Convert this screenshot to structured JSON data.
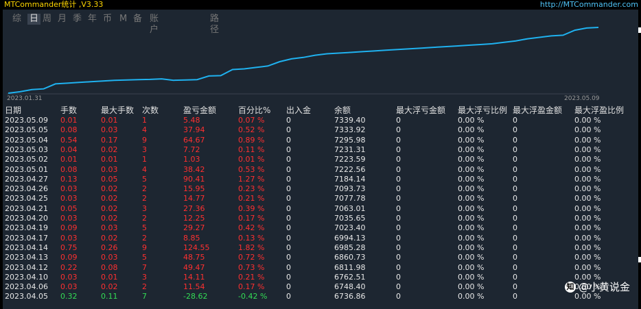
{
  "window": {
    "title": "MTCommander统计 ,V3.33",
    "url": "http://MTCommander.com"
  },
  "tabs": [
    {
      "label": "综",
      "active": false
    },
    {
      "label": "日",
      "active": true
    },
    {
      "label": "周",
      "active": false
    },
    {
      "label": "月",
      "active": false
    },
    {
      "label": "季",
      "active": false
    },
    {
      "label": "年",
      "active": false
    },
    {
      "label": "币",
      "active": false
    },
    {
      "label": "M",
      "active": false
    },
    {
      "label": "备",
      "active": false
    },
    {
      "label": "账户",
      "active": false
    },
    {
      "label": "路径",
      "active": false
    }
  ],
  "chart_data": {
    "type": "line",
    "x_start_label": "2023.01.31",
    "x_end_label": "2023.05.09",
    "values": [
      6420,
      6440,
      6470,
      6480,
      6550,
      6560,
      6570,
      6580,
      6590,
      6600,
      6605,
      6610,
      6612,
      6620,
      6600,
      6605,
      6610,
      6660,
      6665,
      6750,
      6760,
      6780,
      6800,
      6860,
      6900,
      6920,
      6950,
      6970,
      6980,
      6990,
      7000,
      7010,
      7020,
      7030,
      7040,
      7050,
      7060,
      7070,
      7080,
      7090,
      7100,
      7110,
      7130,
      7150,
      7180,
      7200,
      7220,
      7230,
      7300,
      7330,
      7339
    ],
    "line_color": "#1fb2f0"
  },
  "table": {
    "headers": [
      "日期",
      "手数",
      "最大手数",
      "次数",
      "盈亏金额",
      "百分比%",
      "出入金",
      "余额",
      "最大浮亏金额",
      "最大浮亏比例",
      "最大浮盈金额",
      "最大浮盈比例"
    ],
    "rows": [
      {
        "date": "2023.05.09",
        "lots": "0.01",
        "max_lots": "0.01",
        "count": "1",
        "pnl": "5.48",
        "pct": "0.07 %",
        "io": "0",
        "balance": "7339.40",
        "mfl": "0",
        "mflp": "0.00 %",
        "mfp": "0",
        "mfpp": "0.00 %",
        "sign": "pos"
      },
      {
        "date": "2023.05.05",
        "lots": "0.08",
        "max_lots": "0.03",
        "count": "4",
        "pnl": "37.94",
        "pct": "0.52 %",
        "io": "0",
        "balance": "7333.92",
        "mfl": "0",
        "mflp": "0.00 %",
        "mfp": "0",
        "mfpp": "0.00 %",
        "sign": "pos"
      },
      {
        "date": "2023.05.04",
        "lots": "0.54",
        "max_lots": "0.17",
        "count": "9",
        "pnl": "64.67",
        "pct": "0.89 %",
        "io": "0",
        "balance": "7295.98",
        "mfl": "0",
        "mflp": "0.00 %",
        "mfp": "0",
        "mfpp": "0.00 %",
        "sign": "pos"
      },
      {
        "date": "2023.05.03",
        "lots": "0.04",
        "max_lots": "0.02",
        "count": "3",
        "pnl": "7.72",
        "pct": "0.11 %",
        "io": "0",
        "balance": "7231.31",
        "mfl": "0",
        "mflp": "0.00 %",
        "mfp": "0",
        "mfpp": "0.00 %",
        "sign": "pos"
      },
      {
        "date": "2023.05.02",
        "lots": "0.01",
        "max_lots": "0.01",
        "count": "1",
        "pnl": "1.03",
        "pct": "0.01 %",
        "io": "0",
        "balance": "7223.59",
        "mfl": "0",
        "mflp": "0.00 %",
        "mfp": "0",
        "mfpp": "0.00 %",
        "sign": "pos"
      },
      {
        "date": "2023.05.01",
        "lots": "0.08",
        "max_lots": "0.03",
        "count": "4",
        "pnl": "38.42",
        "pct": "0.53 %",
        "io": "0",
        "balance": "7222.56",
        "mfl": "0",
        "mflp": "0.00 %",
        "mfp": "0",
        "mfpp": "0.00 %",
        "sign": "pos"
      },
      {
        "date": "2023.04.27",
        "lots": "0.13",
        "max_lots": "0.05",
        "count": "5",
        "pnl": "90.41",
        "pct": "1.27 %",
        "io": "0",
        "balance": "7184.14",
        "mfl": "0",
        "mflp": "0.00 %",
        "mfp": "0",
        "mfpp": "0.00 %",
        "sign": "pos"
      },
      {
        "date": "2023.04.26",
        "lots": "0.03",
        "max_lots": "0.02",
        "count": "2",
        "pnl": "15.95",
        "pct": "0.23 %",
        "io": "0",
        "balance": "7093.73",
        "mfl": "0",
        "mflp": "0.00 %",
        "mfp": "0",
        "mfpp": "0.00 %",
        "sign": "pos"
      },
      {
        "date": "2023.04.25",
        "lots": "0.03",
        "max_lots": "0.02",
        "count": "2",
        "pnl": "14.77",
        "pct": "0.21 %",
        "io": "0",
        "balance": "7077.78",
        "mfl": "0",
        "mflp": "0.00 %",
        "mfp": "0",
        "mfpp": "0.00 %",
        "sign": "pos"
      },
      {
        "date": "2023.04.21",
        "lots": "0.05",
        "max_lots": "0.02",
        "count": "3",
        "pnl": "27.36",
        "pct": "0.39 %",
        "io": "0",
        "balance": "7063.01",
        "mfl": "0",
        "mflp": "0.00 %",
        "mfp": "0",
        "mfpp": "0.00 %",
        "sign": "pos"
      },
      {
        "date": "2023.04.20",
        "lots": "0.03",
        "max_lots": "0.02",
        "count": "2",
        "pnl": "12.25",
        "pct": "0.17 %",
        "io": "0",
        "balance": "7035.65",
        "mfl": "0",
        "mflp": "0.00 %",
        "mfp": "0",
        "mfpp": "0.00 %",
        "sign": "pos"
      },
      {
        "date": "2023.04.19",
        "lots": "0.09",
        "max_lots": "0.03",
        "count": "5",
        "pnl": "29.27",
        "pct": "0.42 %",
        "io": "0",
        "balance": "7023.40",
        "mfl": "0",
        "mflp": "0.00 %",
        "mfp": "0",
        "mfpp": "0.00 %",
        "sign": "pos"
      },
      {
        "date": "2023.04.17",
        "lots": "0.03",
        "max_lots": "0.02",
        "count": "2",
        "pnl": "8.85",
        "pct": "0.13 %",
        "io": "0",
        "balance": "6994.13",
        "mfl": "0",
        "mflp": "0.00 %",
        "mfp": "0",
        "mfpp": "0.00 %",
        "sign": "pos"
      },
      {
        "date": "2023.04.14",
        "lots": "0.75",
        "max_lots": "0.26",
        "count": "9",
        "pnl": "124.55",
        "pct": "1.82 %",
        "io": "0",
        "balance": "6985.28",
        "mfl": "0",
        "mflp": "0.00 %",
        "mfp": "0",
        "mfpp": "0.00 %",
        "sign": "pos"
      },
      {
        "date": "2023.04.13",
        "lots": "0.09",
        "max_lots": "0.03",
        "count": "5",
        "pnl": "48.75",
        "pct": "0.72 %",
        "io": "0",
        "balance": "6860.73",
        "mfl": "0",
        "mflp": "0.00 %",
        "mfp": "0",
        "mfpp": "0.00 %",
        "sign": "pos"
      },
      {
        "date": "2023.04.12",
        "lots": "0.22",
        "max_lots": "0.08",
        "count": "7",
        "pnl": "49.47",
        "pct": "0.73 %",
        "io": "0",
        "balance": "6811.98",
        "mfl": "0",
        "mflp": "0.00 %",
        "mfp": "0",
        "mfpp": "0.00 %",
        "sign": "pos"
      },
      {
        "date": "2023.04.10",
        "lots": "0.03",
        "max_lots": "0.01",
        "count": "3",
        "pnl": "14.11",
        "pct": "0.21 %",
        "io": "0",
        "balance": "6762.51",
        "mfl": "0",
        "mflp": "0.00 %",
        "mfp": "0",
        "mfpp": "0.00 %",
        "sign": "pos"
      },
      {
        "date": "2023.04.06",
        "lots": "0.03",
        "max_lots": "0.02",
        "count": "2",
        "pnl": "11.54",
        "pct": "0.17 %",
        "io": "0",
        "balance": "6748.40",
        "mfl": "0",
        "mflp": "0.00 %",
        "mfp": "0",
        "mfpp": "0.00 %",
        "sign": "pos"
      },
      {
        "date": "2023.04.05",
        "lots": "0.32",
        "max_lots": "0.11",
        "count": "7",
        "pnl": "-28.62",
        "pct": "-0.42 %",
        "io": "0",
        "balance": "6736.86",
        "mfl": "0",
        "mflp": "0.00 %",
        "mfp": "0",
        "mfpp": "0.00 %",
        "sign": "neg"
      }
    ]
  },
  "watermark": {
    "text": "@小黄说金",
    "icon_label": "知"
  },
  "colors": {
    "positive": "#ff3030",
    "negative": "#33dd55",
    "accent_title": "#ffd700",
    "url": "#4fc3f7"
  }
}
